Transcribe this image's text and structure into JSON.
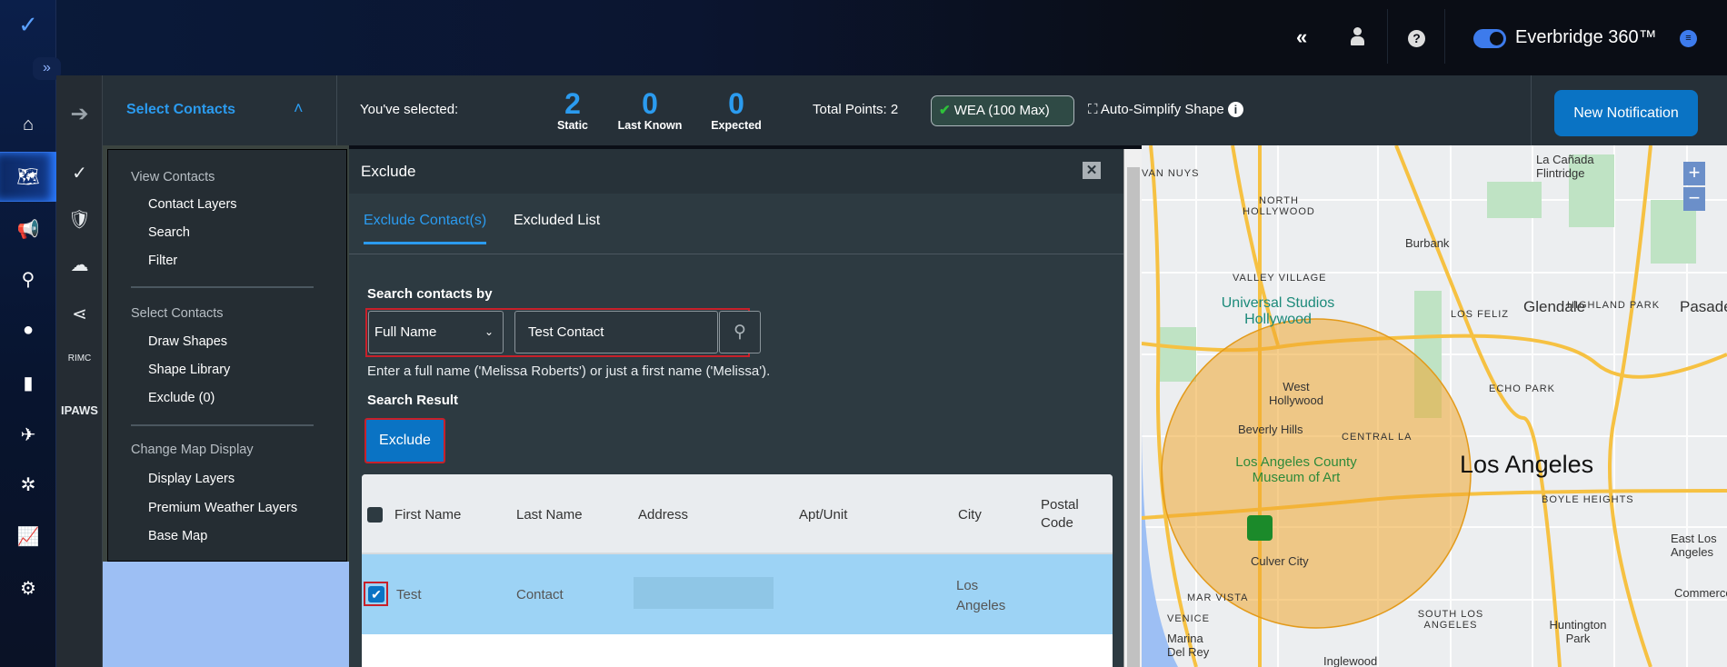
{
  "header": {
    "brand": "Everbridge 360™",
    "icons": [
      "collapse-double-chevron-icon",
      "user-icon",
      "help-icon",
      "toggle-icon",
      "chat-icon"
    ]
  },
  "rail": {
    "icons": [
      "logo-icon",
      "expand-icon",
      "home-icon",
      "map-icon",
      "megaphone-icon",
      "incident-icon",
      "location-pin-icon",
      "report-icon",
      "airplane-icon",
      "network-icon",
      "analytics-icon",
      "settings-icon"
    ]
  },
  "rail2": {
    "rimc": "RIMC",
    "ipaws": "IPAWS"
  },
  "toolbar": {
    "select_contacts": "Select Contacts",
    "youve_selected": "You've selected:",
    "counts": [
      {
        "value": "2",
        "label": "Static"
      },
      {
        "value": "0",
        "label": "Last Known"
      },
      {
        "value": "0",
        "label": "Expected"
      }
    ],
    "total_points": "Total Points: 2",
    "wea": "WEA (100 Max)",
    "auto_simplify": "Auto-Simplify Shape",
    "new_notification": "New Notification"
  },
  "menu": {
    "view_contacts": "View Contacts",
    "contact_layers": "Contact Layers",
    "search": "Search",
    "filter": "Filter",
    "select_contacts": "Select Contacts",
    "draw_shapes": "Draw Shapes",
    "shape_library": "Shape Library",
    "exclude": "Exclude (0)",
    "change_map_display": "Change Map Display",
    "display_layers": "Display Layers",
    "premium_weather": "Premium Weather Layers",
    "base_map": "Base Map"
  },
  "dialog": {
    "title": "Exclude",
    "tabs": [
      "Exclude Contact(s)",
      "Excluded List"
    ],
    "search_by_label": "Search contacts by",
    "search_by_value": "Full Name",
    "search_value": "Test Contact",
    "hint": "Enter a full name ('Melissa Roberts') or just a first name ('Melissa').",
    "search_result": "Search Result",
    "exclude_button": "Exclude",
    "table": {
      "headers": [
        "First Name",
        "Last Name",
        "Address",
        "Apt/Unit",
        "City",
        "Postal Code"
      ],
      "rows": [
        {
          "checked": true,
          "first": "Test",
          "last": "Contact",
          "address": "",
          "apt": "",
          "city": "Los Angeles",
          "postal": ""
        }
      ]
    }
  },
  "map": {
    "zoom_in": "+",
    "zoom_out": "−",
    "labels": [
      "VAN NUYS",
      "NORTH HOLLYWOOD",
      "Burbank",
      "La Cañada Flintridge",
      "VALLEY VILLAGE",
      "Universal Studios Hollywood",
      "Glendale",
      "Pasadena",
      "West Hollywood",
      "Beverly Hills",
      "CENTRAL LA",
      "Los Angeles County Museum of Art",
      "Los Angeles",
      "BOYLE HEIGHTS",
      "Culver City",
      "ECHO PARK",
      "HIGHLAND PARK",
      "LOS FELIZ",
      "MAR VISTA",
      "VENICE",
      "Marina Del Rey",
      "SOUTH LOS ANGELES",
      "Huntington Park",
      "East Los Angeles",
      "Commerce",
      "Inglewood"
    ],
    "circle_color": "#f0a830"
  }
}
